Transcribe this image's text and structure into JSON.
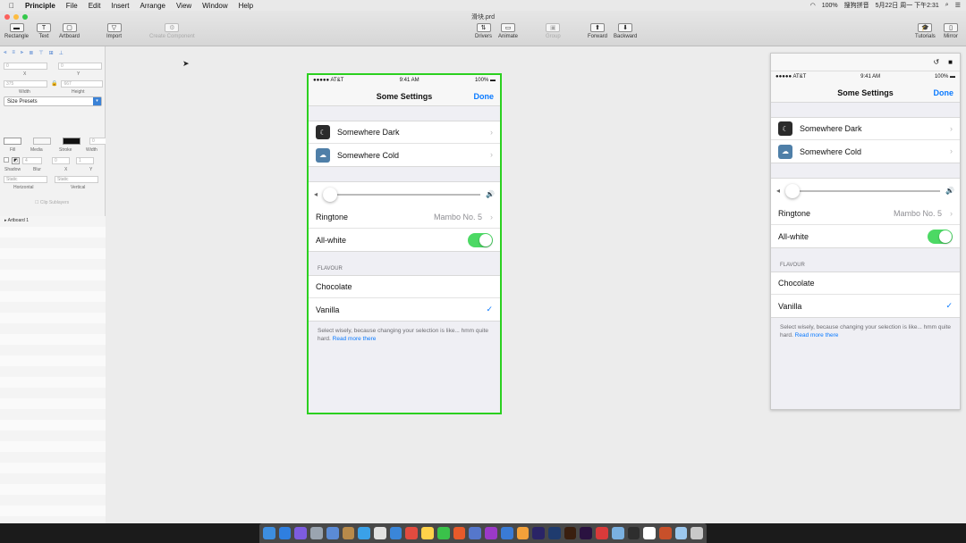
{
  "menubar": {
    "apple_icon": "apple-icon",
    "app": "Principle",
    "items": [
      "File",
      "Edit",
      "Insert",
      "Arrange",
      "View",
      "Window",
      "Help"
    ],
    "battery": "100%",
    "input_method": "搜狗拼音",
    "datetime": "5月22日 周一 下午2:31"
  },
  "window": {
    "doc_title": "滑块.prd",
    "toolbar_left": [
      {
        "label": "Rectangle",
        "glyph": "▬"
      },
      {
        "label": "Text",
        "glyph": "T"
      },
      {
        "label": "Artboard",
        "glyph": "▢"
      },
      {
        "label": "Import",
        "glyph": "▽"
      },
      {
        "label": "Create Component",
        "glyph": "⚙"
      }
    ],
    "toolbar_right": [
      {
        "label": "Drivers",
        "glyph": "⇅"
      },
      {
        "label": "Animate",
        "glyph": "▭"
      },
      {
        "label": "Group",
        "glyph": "▣"
      },
      {
        "label": "Forward",
        "glyph": "⬆"
      },
      {
        "label": "Backward",
        "glyph": "⬇"
      },
      {
        "label": "Tutorials",
        "glyph": "🎓"
      },
      {
        "label": "Mirror",
        "glyph": "▯"
      }
    ]
  },
  "inspector": {
    "x_value": "0",
    "y_value": "0",
    "x_label": "X",
    "y_label": "Y",
    "width_value": "375",
    "height_value": "667",
    "width_label": "Width",
    "height_label": "Height",
    "size_presets": "Size Presets",
    "fill_label": "Fill",
    "media_label": "Media",
    "stroke_label": "Stroke",
    "stroke_width_label": "Width",
    "stroke_width_value": "0",
    "shadow_label": "Shadow",
    "blur_label": "Blur",
    "blur_value": "4",
    "shadow_x_value": "0",
    "shadow_y_value": "1",
    "shadow_x_label": "X",
    "shadow_y_label": "Y",
    "horizontal_value": "Static",
    "vertical_value": "Static",
    "horizontal_label": "Horizontal",
    "vertical_label": "Vertical",
    "clip_sublayers": "Clip Sublayers"
  },
  "layers": {
    "artboard": "Artboard 1"
  },
  "phone": {
    "carrier": "●●●●● AT&T",
    "time": "9:41 AM",
    "battery": "100%",
    "title": "Some Settings",
    "done": "Done",
    "themes": [
      {
        "label": "Somewhere Dark",
        "color": "#2b2b2b"
      },
      {
        "label": "Somewhere Cold",
        "color": "#4f7fa8"
      }
    ],
    "ringtone_label": "Ringtone",
    "ringtone_value": "Mambo No. 5",
    "allwhite_label": "All-white",
    "allwhite_on": true,
    "volume_level": 0,
    "section_header": "FLAVOUR",
    "flavours": [
      {
        "label": "Chocolate",
        "checked": false
      },
      {
        "label": "Vanilla",
        "checked": true
      }
    ],
    "footer_text": "Select wisely, because changing your selection is like... hmm quite hard.",
    "footer_link": "Read more there"
  },
  "mirror": {
    "undo_icon": "undo-icon",
    "camera_icon": "video-camera-icon"
  },
  "colors": {
    "selection": "#2bd01f",
    "tint": "#0a7aff",
    "toggle_on": "#4cd964"
  }
}
